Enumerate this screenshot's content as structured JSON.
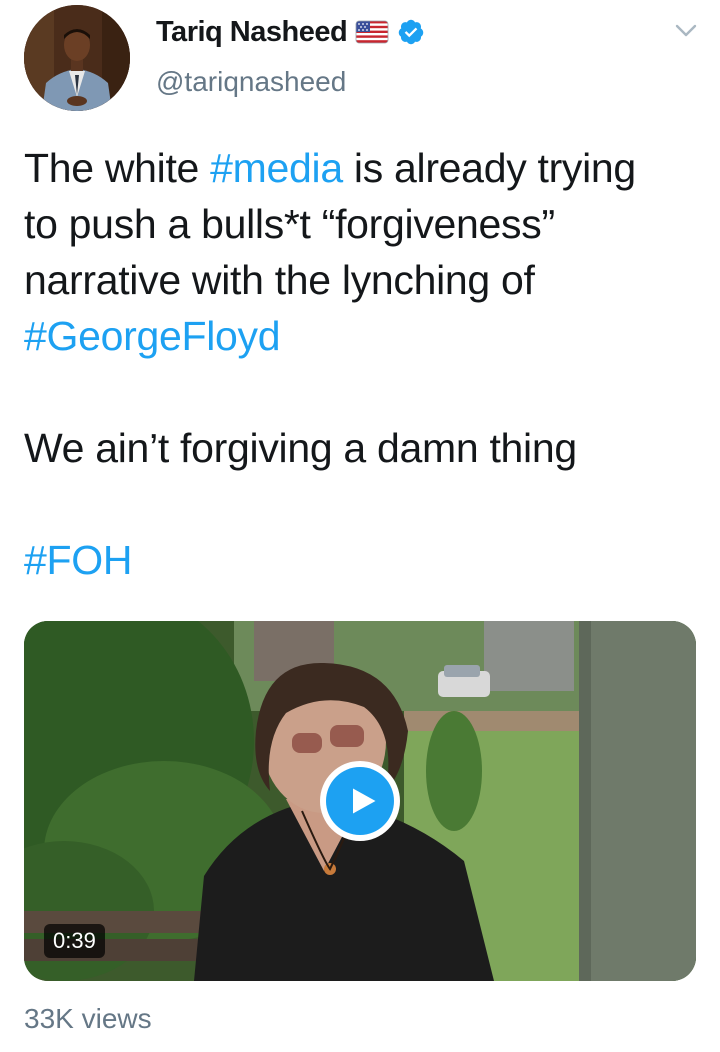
{
  "author": {
    "display_name": "Tariq Nasheed",
    "handle": "@tariqnasheed",
    "flag_icon": "us-flag-emoji",
    "verified_icon": "verified-badge-icon"
  },
  "tweet": {
    "lines": [
      [
        {
          "t": "The white "
        },
        {
          "t": "#media",
          "tag": true
        },
        {
          "t": " is already trying"
        }
      ],
      [
        {
          "t": "to push a bulls*t “forgiveness”"
        }
      ],
      [
        {
          "t": "narrative with the lynching of"
        }
      ],
      [
        {
          "t": "#GeorgeFloyd",
          "tag": true
        }
      ],
      [],
      [
        {
          "t": "We ain’t forgiving a damn thing"
        }
      ],
      [],
      [
        {
          "t": "#FOH",
          "tag": true
        }
      ]
    ]
  },
  "media": {
    "duration": "0:39",
    "play_icon": "play-icon"
  },
  "stats": {
    "views": "33K views"
  },
  "colors": {
    "link": "#1da1f2",
    "secondary_text": "#657786",
    "primary_text": "#14171a"
  }
}
